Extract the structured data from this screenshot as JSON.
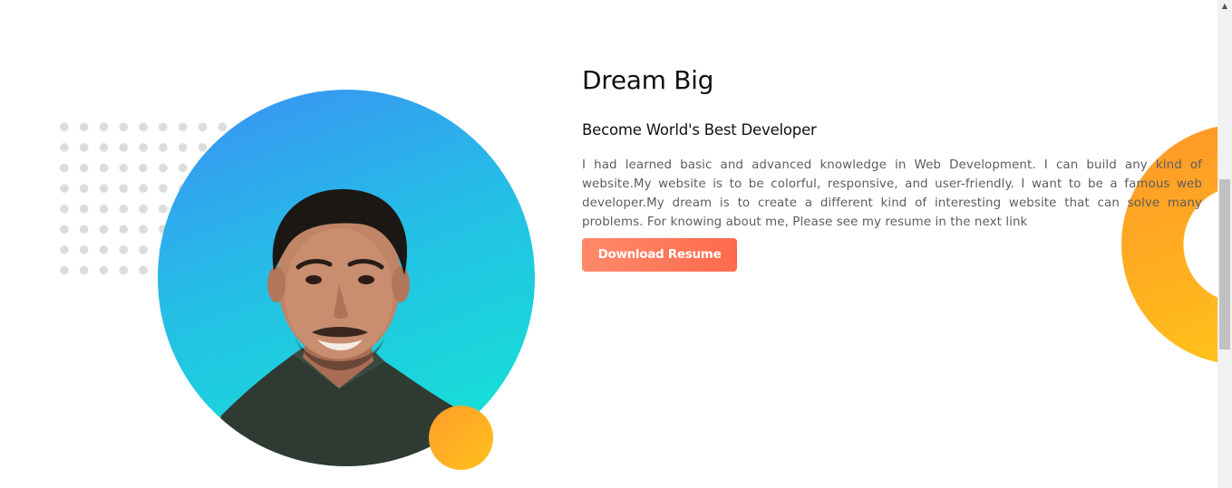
{
  "about": {
    "title": "Dream Big",
    "subtitle": "Become World's Best Developer",
    "description": "I had learned basic and advanced knowledge in Web Development. I can build any kind of website.My website is to be colorful, responsive, and user-friendly. I want to be a famous web developer.My dream is to create a different kind of interesting website that can solve many problems. For knowing about me, Please see my resume in the next link",
    "download_button": "Download Resume"
  },
  "colors": {
    "button_start": "#ff8a6a",
    "button_end": "#ff6a4c",
    "circle_start": "#3b8ff5",
    "circle_end": "#12e8d2",
    "accent_yellow": "#ffb11f"
  },
  "scrollbar": {
    "up_arrow": "▲"
  }
}
